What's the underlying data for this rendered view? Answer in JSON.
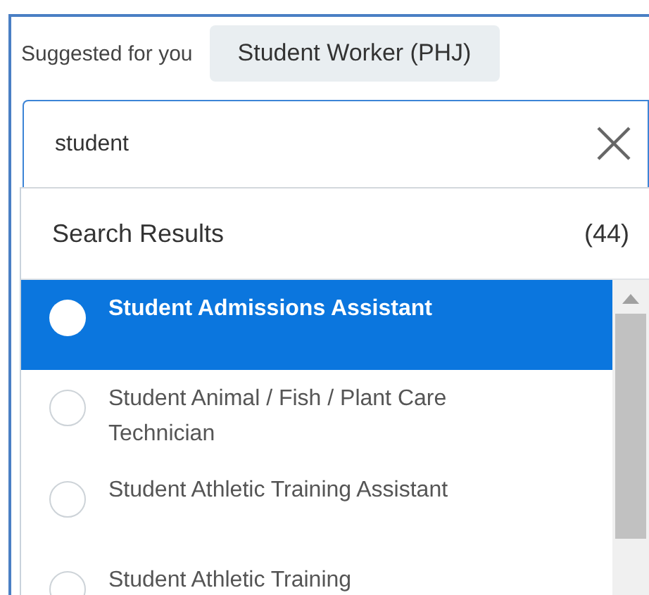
{
  "suggested": {
    "label": "Suggested for you",
    "chip": "Student Worker (PHJ)"
  },
  "search": {
    "value": "student"
  },
  "results": {
    "title": "Search Results",
    "count": "(44)",
    "items": [
      {
        "label": "Student Admissions Assistant",
        "selected": true
      },
      {
        "label": "Student Animal / Fish / Plant Care Technician",
        "selected": false
      },
      {
        "label": "Student Athletic Training Assistant",
        "selected": false
      },
      {
        "label": "Student Athletic Training",
        "selected": false
      }
    ]
  }
}
